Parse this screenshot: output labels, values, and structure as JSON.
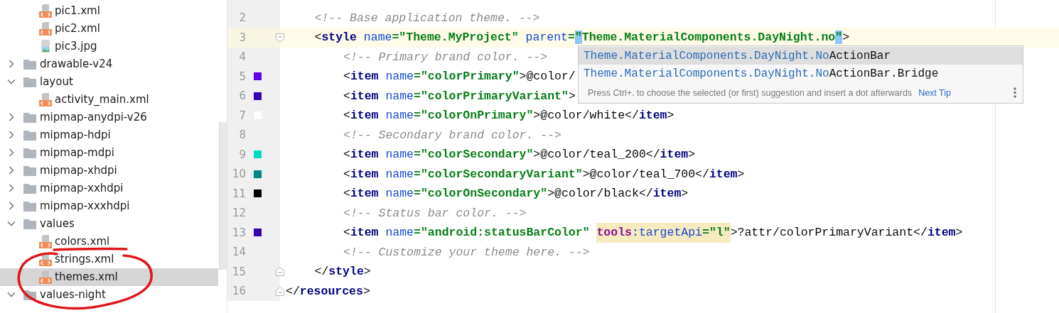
{
  "project_tree": {
    "items": [
      {
        "kind": "folder-continued",
        "children": [
          {
            "kind": "xml-file",
            "label": "pic1.xml",
            "selected": false
          },
          {
            "kind": "xml-file",
            "label": "pic2.xml",
            "selected": false
          },
          {
            "kind": "image-file",
            "label": "pic3.jpg",
            "selected": false
          }
        ]
      },
      {
        "kind": "folder",
        "label": "drawable-v24",
        "expanded": false,
        "selected": false
      },
      {
        "kind": "folder",
        "label": "layout",
        "expanded": true,
        "selected": false,
        "children": [
          {
            "kind": "xml-file",
            "label": "activity_main.xml",
            "selected": false
          }
        ]
      },
      {
        "kind": "folder",
        "label": "mipmap-anydpi-v26",
        "expanded": false,
        "selected": false
      },
      {
        "kind": "folder",
        "label": "mipmap-hdpi",
        "expanded": false,
        "selected": false
      },
      {
        "kind": "folder",
        "label": "mipmap-mdpi",
        "expanded": false,
        "selected": false
      },
      {
        "kind": "folder",
        "label": "mipmap-xhdpi",
        "expanded": false,
        "selected": false
      },
      {
        "kind": "folder",
        "label": "mipmap-xxhdpi",
        "expanded": false,
        "selected": false
      },
      {
        "kind": "folder",
        "label": "mipmap-xxxhdpi",
        "expanded": false,
        "selected": false
      },
      {
        "kind": "folder",
        "label": "values",
        "expanded": true,
        "selected": false,
        "children": [
          {
            "kind": "xml-file",
            "label": "colors.xml",
            "selected": false
          },
          {
            "kind": "xml-file",
            "label": "strings.xml",
            "selected": false
          },
          {
            "kind": "xml-file",
            "label": "themes.xml",
            "selected": true
          }
        ]
      },
      {
        "kind": "folder",
        "label": "values-night",
        "expanded": true,
        "selected": false
      }
    ]
  },
  "editor": {
    "lines": [
      {
        "kind": "continued",
        "children": [
          {
            "number": "2",
            "current": false,
            "tokens": [
              {
                "kind": "comment",
                "text": "<!-- Base application theme. -->"
              }
            ]
          },
          {
            "number": "3",
            "current": true,
            "tokens": [
              {
                "kind": "punct",
                "text": "<"
              },
              {
                "kind": "tag",
                "text": "style"
              },
              {
                "kind": "attr",
                "text": " name"
              },
              {
                "kind": "value",
                "text": "=\"Theme.MyProject\""
              },
              {
                "kind": "attr",
                "text": " parent"
              },
              {
                "kind": "value",
                "text": "="
              },
              {
                "kind": "marked-value",
                "text": "\""
              },
              {
                "kind": "value",
                "text": "Theme.MaterialComponents.DayNight.no"
              },
              {
                "kind": "marked-value",
                "text": "\""
              },
              {
                "kind": "punct",
                "text": ">"
              }
            ],
            "children": [
              {
                "number": "4",
                "current": false,
                "tokens": [
                  {
                    "kind": "comment",
                    "text": "<!-- Primary brand color. -->"
                  }
                ]
              },
              {
                "number": "5",
                "current": false,
                "color": "#6200ee",
                "tokens": [
                  {
                    "kind": "punct",
                    "text": "<"
                  },
                  {
                    "kind": "tag",
                    "text": "item"
                  },
                  {
                    "kind": "attr",
                    "text": " name"
                  },
                  {
                    "kind": "value",
                    "text": "=\"colorPrimary\""
                  },
                  {
                    "kind": "punct",
                    "text": ">@color/"
                  }
                ]
              },
              {
                "number": "6",
                "current": false,
                "color": "#3700b3",
                "tokens": [
                  {
                    "kind": "punct",
                    "text": "<"
                  },
                  {
                    "kind": "tag",
                    "text": "item"
                  },
                  {
                    "kind": "attr",
                    "text": " name"
                  },
                  {
                    "kind": "value",
                    "text": "=\"colorPrimaryVariant\""
                  },
                  {
                    "kind": "punct",
                    "text": ">"
                  }
                ]
              },
              {
                "number": "7",
                "current": false,
                "color": "#ffffff",
                "tokens": [
                  {
                    "kind": "punct",
                    "text": "<"
                  },
                  {
                    "kind": "tag",
                    "text": "item"
                  },
                  {
                    "kind": "attr",
                    "text": " name"
                  },
                  {
                    "kind": "value",
                    "text": "=\"colorOnPrimary\""
                  },
                  {
                    "kind": "punct",
                    "text": ">@color/white</"
                  },
                  {
                    "kind": "tag",
                    "text": "item"
                  },
                  {
                    "kind": "punct",
                    "text": ">"
                  }
                ]
              },
              {
                "number": "8",
                "current": false,
                "tokens": [
                  {
                    "kind": "comment",
                    "text": "<!-- Secondary brand color. -->"
                  }
                ]
              },
              {
                "number": "9",
                "current": false,
                "color": "#03dac5",
                "tokens": [
                  {
                    "kind": "punct",
                    "text": "<"
                  },
                  {
                    "kind": "tag",
                    "text": "item"
                  },
                  {
                    "kind": "attr",
                    "text": " name"
                  },
                  {
                    "kind": "value",
                    "text": "=\"colorSecondary\""
                  },
                  {
                    "kind": "punct",
                    "text": ">@color/teal_200</"
                  },
                  {
                    "kind": "tag",
                    "text": "item"
                  },
                  {
                    "kind": "punct",
                    "text": ">"
                  }
                ]
              },
              {
                "number": "10",
                "current": false,
                "color": "#018786",
                "tokens": [
                  {
                    "kind": "punct",
                    "text": "<"
                  },
                  {
                    "kind": "tag",
                    "text": "item"
                  },
                  {
                    "kind": "attr",
                    "text": " name"
                  },
                  {
                    "kind": "value",
                    "text": "=\"colorSecondaryVariant\""
                  },
                  {
                    "kind": "punct",
                    "text": ">@color/teal_700</"
                  },
                  {
                    "kind": "tag",
                    "text": "item"
                  },
                  {
                    "kind": "punct",
                    "text": ">"
                  }
                ]
              },
              {
                "number": "11",
                "current": false,
                "color": "#000000",
                "tokens": [
                  {
                    "kind": "punct",
                    "text": "<"
                  },
                  {
                    "kind": "tag",
                    "text": "item"
                  },
                  {
                    "kind": "attr",
                    "text": " name"
                  },
                  {
                    "kind": "value",
                    "text": "=\"colorOnSecondary\""
                  },
                  {
                    "kind": "punct",
                    "text": ">@color/black</"
                  },
                  {
                    "kind": "tag",
                    "text": "item"
                  },
                  {
                    "kind": "punct",
                    "text": ">"
                  }
                ]
              },
              {
                "number": "12",
                "current": false,
                "tokens": [
                  {
                    "kind": "comment",
                    "text": "<!-- Status bar color. -->"
                  }
                ]
              },
              {
                "number": "13",
                "current": false,
                "color": "#3700b3",
                "tokens": [
                  {
                    "kind": "punct",
                    "text": "<"
                  },
                  {
                    "kind": "tag",
                    "text": "item"
                  },
                  {
                    "kind": "attr",
                    "text": " name"
                  },
                  {
                    "kind": "value",
                    "text": "=\"android:statusBarColor\""
                  },
                  {
                    "kind": "spaced-highlight",
                    "tokens": [
                      {
                        "kind": "namespace",
                        "text": "tools"
                      },
                      {
                        "kind": "attr",
                        "text": ":targetApi"
                      },
                      {
                        "kind": "value",
                        "text": "=\"l\""
                      }
                    ]
                  },
                  {
                    "kind": "punct",
                    "text": ">?attr/colorPrimaryVariant</"
                  },
                  {
                    "kind": "tag",
                    "text": "item"
                  },
                  {
                    "kind": "punct",
                    "text": ">"
                  }
                ]
              },
              {
                "number": "14",
                "current": false,
                "tokens": [
                  {
                    "kind": "comment",
                    "text": "<!-- Customize your theme here. -->"
                  }
                ]
              }
            ]
          },
          {
            "number": "15",
            "current": false,
            "fold_end": true,
            "tokens": [
              {
                "kind": "punct",
                "text": "</"
              },
              {
                "kind": "tag",
                "text": "style"
              },
              {
                "kind": "punct",
                "text": ">"
              }
            ]
          }
        ]
      },
      {
        "number": "16",
        "current": false,
        "fold_end": true,
        "tokens": [
          {
            "kind": "punct",
            "text": "</"
          },
          {
            "kind": "tag",
            "text": "resources"
          },
          {
            "kind": "punct",
            "text": ">"
          }
        ]
      }
    ]
  },
  "completion_popup": {
    "suggestions": [
      {
        "match": "Theme.MaterialComponents.DayNight.No",
        "rest": "ActionBar",
        "selected": true
      },
      {
        "match": "Theme.MaterialComponents.DayNight.No",
        "rest": "ActionBar.Bridge",
        "selected": false
      }
    ],
    "hint": "Press Ctrl+. to choose the selected (or first) suggestion and insert a dot afterwards",
    "link": "Next Tip"
  }
}
